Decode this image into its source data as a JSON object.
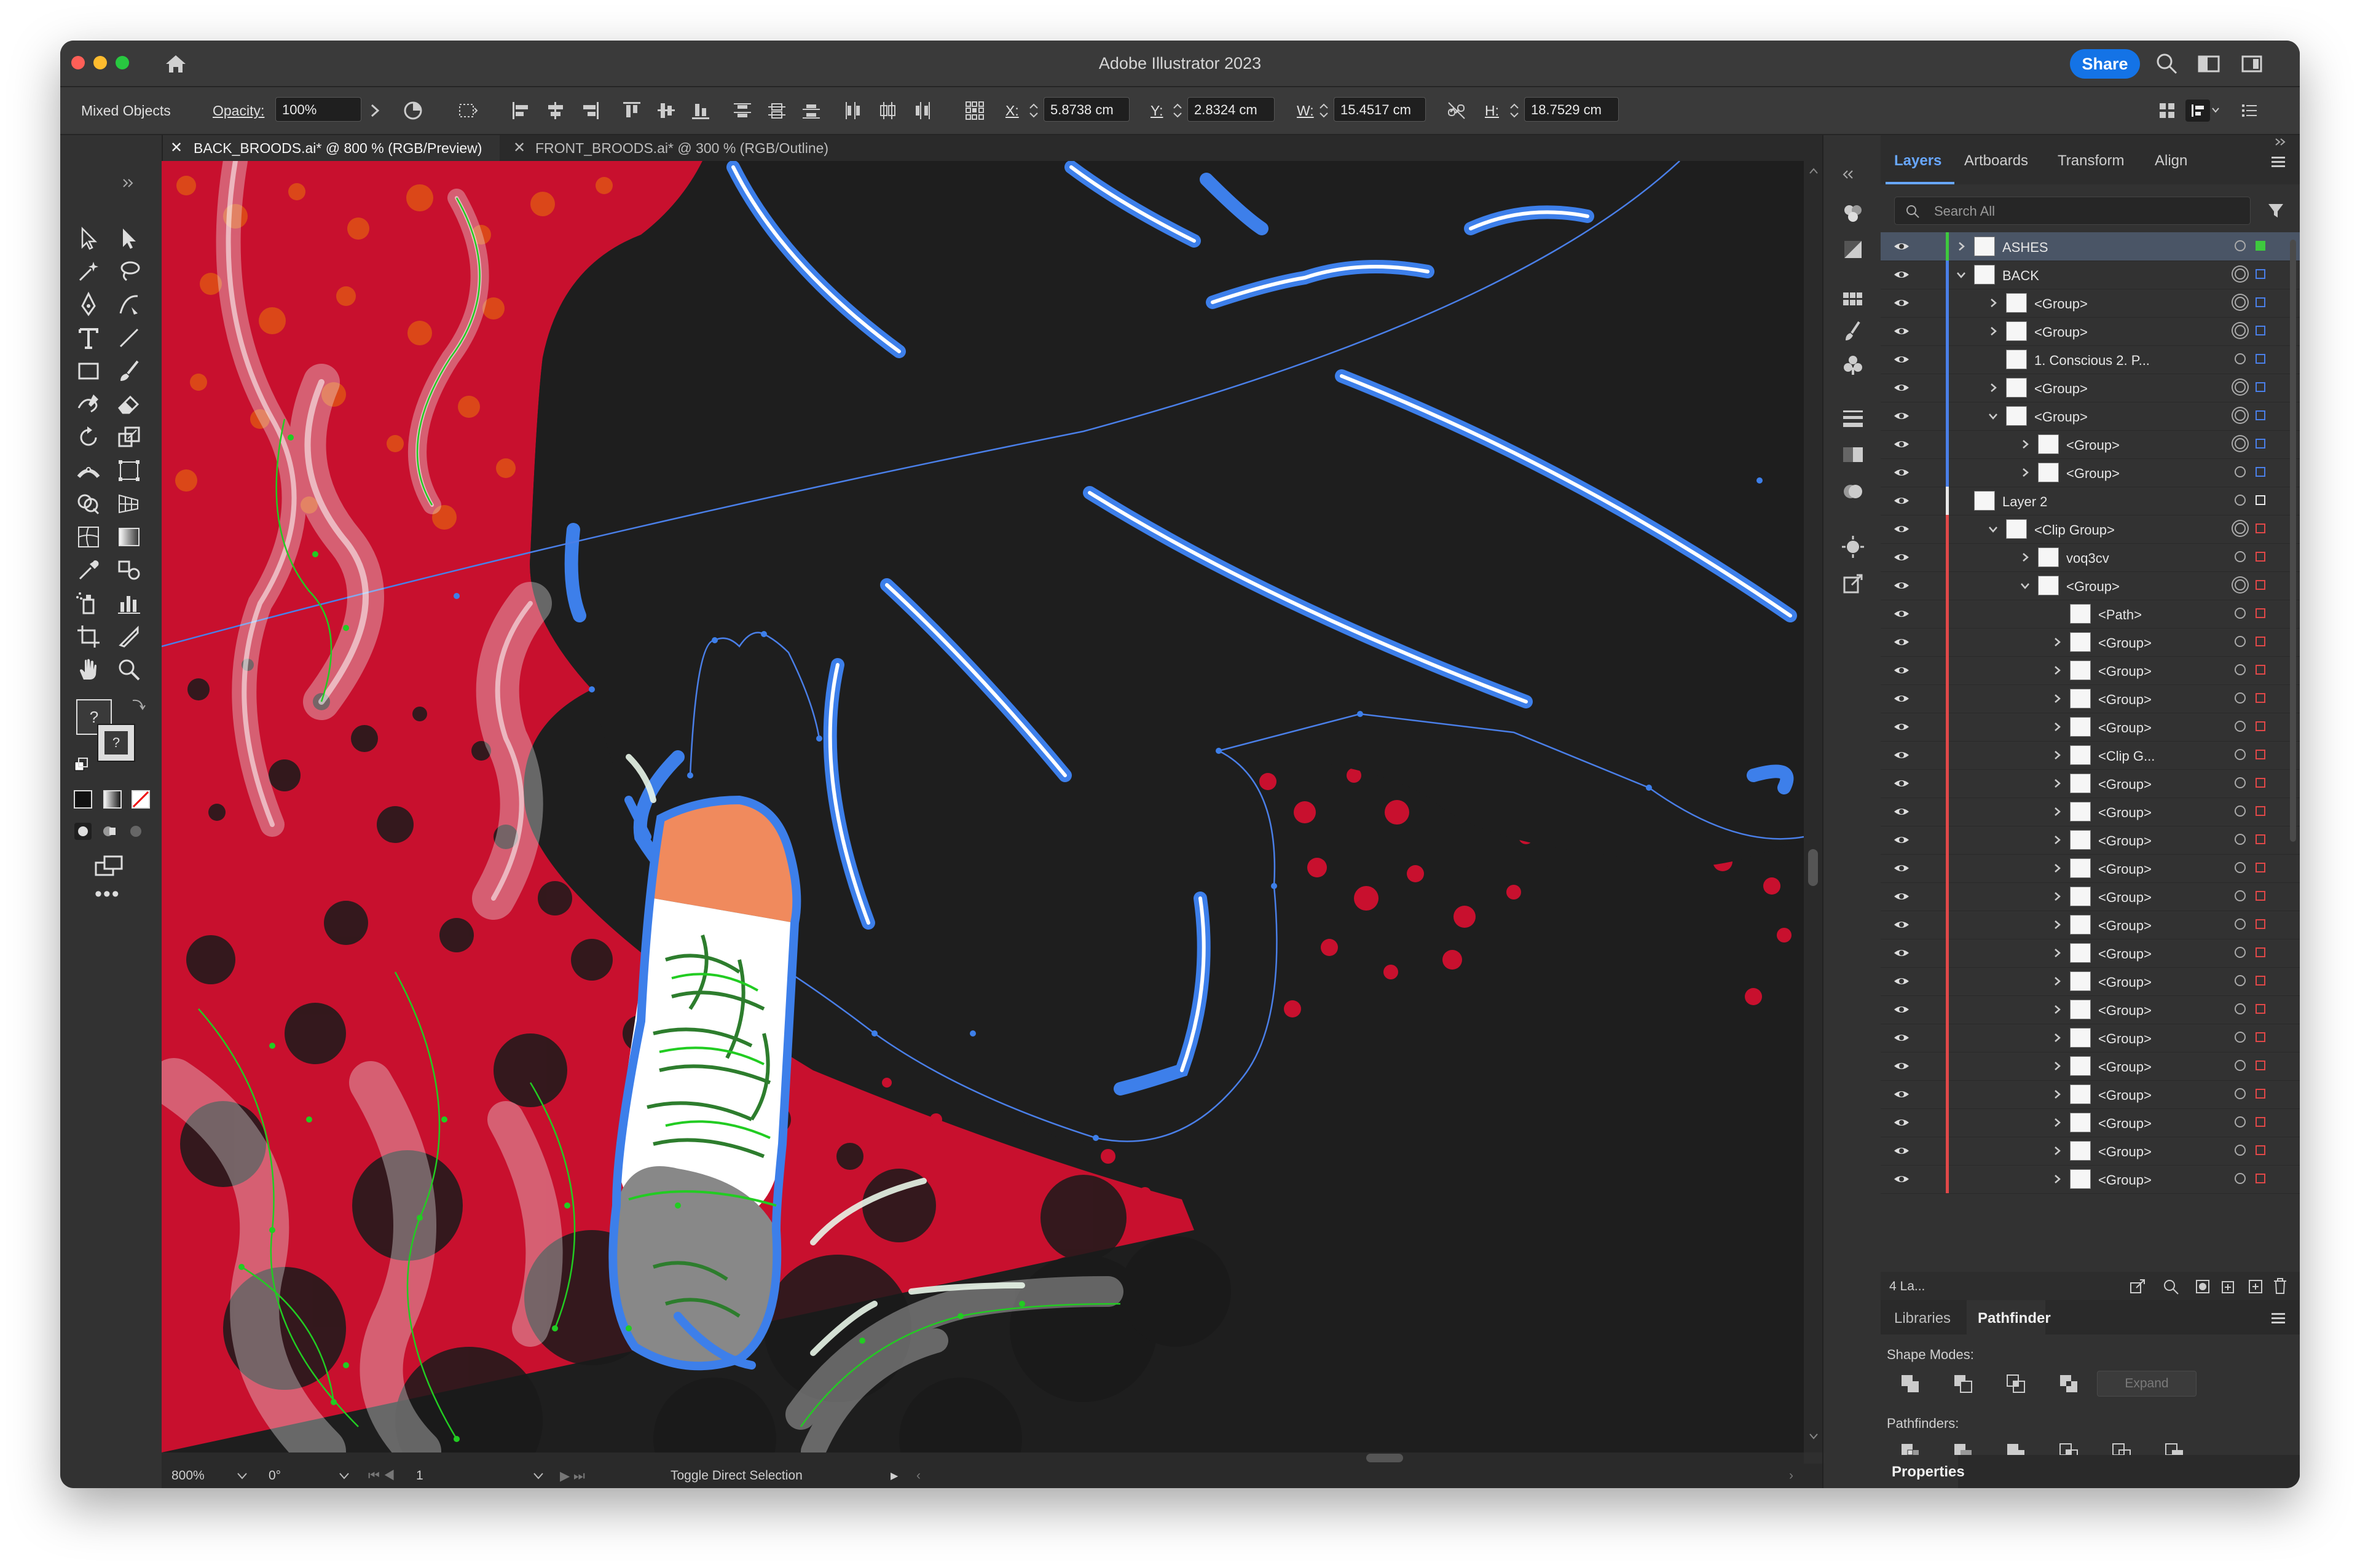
{
  "window": {
    "title": "Adobe Illustrator 2023",
    "share_label": "Share"
  },
  "control_bar": {
    "selection": "Mixed Objects",
    "opacity_label": "Opacity:",
    "opacity_value": "100%",
    "x_label": "X:",
    "x_value": "5.8738 cm",
    "y_label": "Y:",
    "y_value": "2.8324 cm",
    "w_label": "W:",
    "w_value": "15.4517 cm",
    "h_label": "H:",
    "h_value": "18.7529 cm"
  },
  "doc_tabs": [
    {
      "label": "BACK_BROODS.ai* @ 800 % (RGB/Preview)",
      "active": true
    },
    {
      "label": "FRONT_BROODS.ai* @ 300 % (RGB/Outline)",
      "active": false
    }
  ],
  "status_bar": {
    "zoom": "800%",
    "rotation": "0°",
    "artboard": "1",
    "tool_hint": "Toggle Direct Selection"
  },
  "layers_panel": {
    "tabs": [
      "Layers",
      "Artboards",
      "Transform",
      "Align"
    ],
    "active_tab": "Layers",
    "search_placeholder": "Search All",
    "footer_count": "4 La...",
    "rows": [
      {
        "name": "ASHES",
        "indent": 0,
        "twirl": "right",
        "color": "#3ec93e",
        "selected": true
      },
      {
        "name": "BACK",
        "indent": 0,
        "twirl": "down",
        "color": "#4a7fe8"
      },
      {
        "name": "<Group>",
        "indent": 1,
        "twirl": "right",
        "color": "#4a7fe8"
      },
      {
        "name": "<Group>",
        "indent": 1,
        "twirl": "right",
        "color": "#4a7fe8"
      },
      {
        "name": "1. Conscious 2. P...",
        "indent": 1,
        "twirl": "none",
        "color": "#4a7fe8"
      },
      {
        "name": "<Group>",
        "indent": 1,
        "twirl": "right",
        "color": "#4a7fe8"
      },
      {
        "name": "<Group>",
        "indent": 1,
        "twirl": "down",
        "color": "#4a7fe8"
      },
      {
        "name": "<Group>",
        "indent": 2,
        "twirl": "right",
        "color": "#4a7fe8"
      },
      {
        "name": "<Group>",
        "indent": 2,
        "twirl": "right",
        "color": "#4a7fe8"
      },
      {
        "name": "Layer 2",
        "indent": 0,
        "twirl": "none",
        "color": "#e8e8e8"
      },
      {
        "name": "<Clip Group>",
        "indent": 1,
        "twirl": "down",
        "color": "#e04848"
      },
      {
        "name": "voq3cv",
        "indent": 2,
        "twirl": "right",
        "color": "#e04848"
      },
      {
        "name": "<Group>",
        "indent": 2,
        "twirl": "down",
        "color": "#e04848"
      },
      {
        "name": "<Path>",
        "indent": 3,
        "twirl": "none",
        "color": "#e04848"
      },
      {
        "name": "<Group>",
        "indent": 3,
        "twirl": "right",
        "color": "#e04848"
      },
      {
        "name": "<Group>",
        "indent": 3,
        "twirl": "right",
        "color": "#e04848"
      },
      {
        "name": "<Group>",
        "indent": 3,
        "twirl": "right",
        "color": "#e04848"
      },
      {
        "name": "<Group>",
        "indent": 3,
        "twirl": "right",
        "color": "#e04848"
      },
      {
        "name": "<Clip G...",
        "indent": 3,
        "twirl": "right",
        "color": "#e04848"
      },
      {
        "name": "<Group>",
        "indent": 3,
        "twirl": "right",
        "color": "#e04848"
      },
      {
        "name": "<Group>",
        "indent": 3,
        "twirl": "right",
        "color": "#e04848"
      },
      {
        "name": "<Group>",
        "indent": 3,
        "twirl": "right",
        "color": "#e04848"
      },
      {
        "name": "<Group>",
        "indent": 3,
        "twirl": "right",
        "color": "#e04848"
      },
      {
        "name": "<Group>",
        "indent": 3,
        "twirl": "right",
        "color": "#e04848"
      },
      {
        "name": "<Group>",
        "indent": 3,
        "twirl": "right",
        "color": "#e04848"
      },
      {
        "name": "<Group>",
        "indent": 3,
        "twirl": "right",
        "color": "#e04848"
      },
      {
        "name": "<Group>",
        "indent": 3,
        "twirl": "right",
        "color": "#e04848"
      },
      {
        "name": "<Group>",
        "indent": 3,
        "twirl": "right",
        "color": "#e04848"
      },
      {
        "name": "<Group>",
        "indent": 3,
        "twirl": "right",
        "color": "#e04848"
      },
      {
        "name": "<Group>",
        "indent": 3,
        "twirl": "right",
        "color": "#e04848"
      },
      {
        "name": "<Group>",
        "indent": 3,
        "twirl": "right",
        "color": "#e04848"
      },
      {
        "name": "<Group>",
        "indent": 3,
        "twirl": "right",
        "color": "#e04848"
      },
      {
        "name": "<Group>",
        "indent": 3,
        "twirl": "right",
        "color": "#e04848"
      },
      {
        "name": "<Group>",
        "indent": 3,
        "twirl": "right",
        "color": "#e04848"
      }
    ]
  },
  "pathfinder_panel": {
    "tabs": [
      "Libraries",
      "Pathfinder"
    ],
    "active_tab": "Pathfinder",
    "shape_modes_label": "Shape Modes:",
    "pathfinders_label": "Pathfinders:",
    "expand_label": "Expand",
    "properties_label": "Properties"
  },
  "colors": {
    "accent": "#1473e6",
    "canvas_red": "#c8102e",
    "selection_blue": "#3d7fea",
    "path_green": "#22cc22"
  }
}
